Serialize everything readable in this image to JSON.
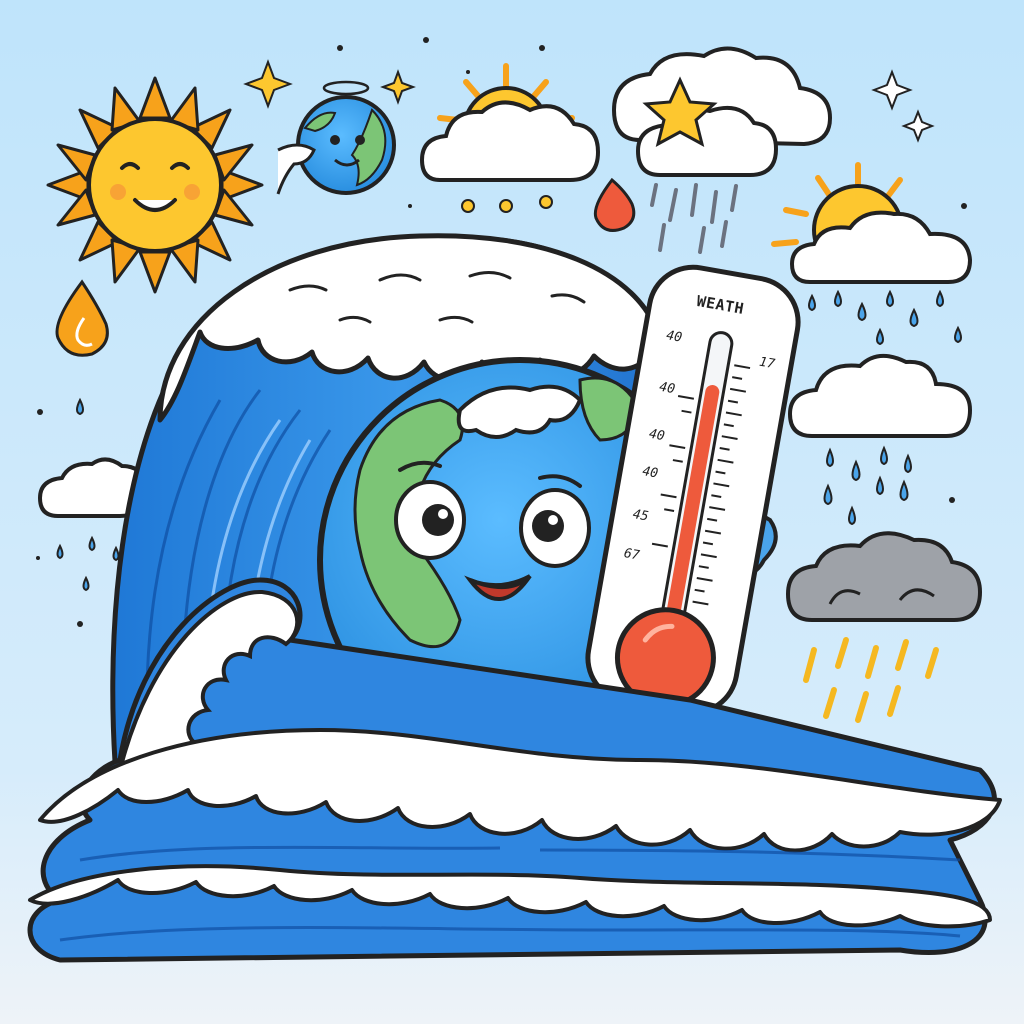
{
  "thermometer": {
    "label": "WEATH",
    "scale_left": [
      "40",
      "40",
      "40",
      "40",
      "45",
      "67"
    ],
    "scale_right_top": "17",
    "fill_level": 0.85
  },
  "colors": {
    "sky_top": "#bfe4fb",
    "sky_bottom": "#eaf3fb",
    "ocean_blue": "#2f86e0",
    "foam": "#ffffff",
    "earth_blue": "#3fa9f5",
    "earth_land": "#7cc576",
    "sun_yellow": "#fdc72f",
    "sun_rays": "#f7a21b",
    "mercury_red": "#ee5a3c",
    "storm_grey": "#8e9196"
  }
}
